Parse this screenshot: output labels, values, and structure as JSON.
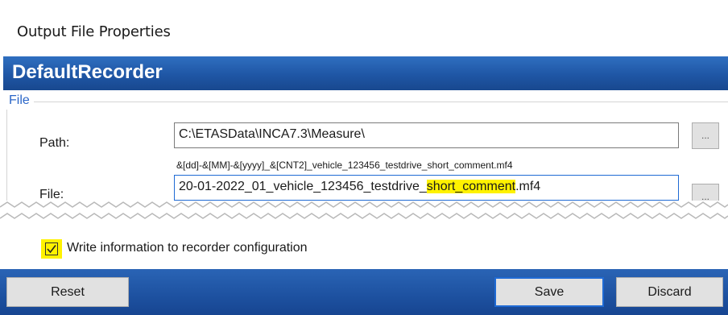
{
  "window": {
    "title": "Output File Properties"
  },
  "header": {
    "title": "DefaultRecorder"
  },
  "file_group": {
    "legend": "File",
    "path": {
      "label": "Path:",
      "value": "C:\\ETASData\\INCA7.3\\Measure\\"
    },
    "pattern_hint": "&[dd]-&[MM]-&[yyyy]_&[CNT2]_vehicle_123456_testdrive_short_comment.mf4",
    "file": {
      "label": "File:",
      "value_prefix": "20-01-2022_01_vehicle_123456_testdrive_",
      "value_highlight": "short_comment",
      "value_suffix": ".mf4"
    },
    "browse_label": "..."
  },
  "options": {
    "write_info_label": "Write information to recorder configuration",
    "write_info_checked": true,
    "highlight_color": "#fff200"
  },
  "footer": {
    "reset_label": "Reset",
    "save_label": "Save",
    "discard_label": "Discard"
  },
  "colors": {
    "accent": "#1f56a5",
    "legend": "#2a66c8",
    "focus": "#1f6ad4"
  }
}
